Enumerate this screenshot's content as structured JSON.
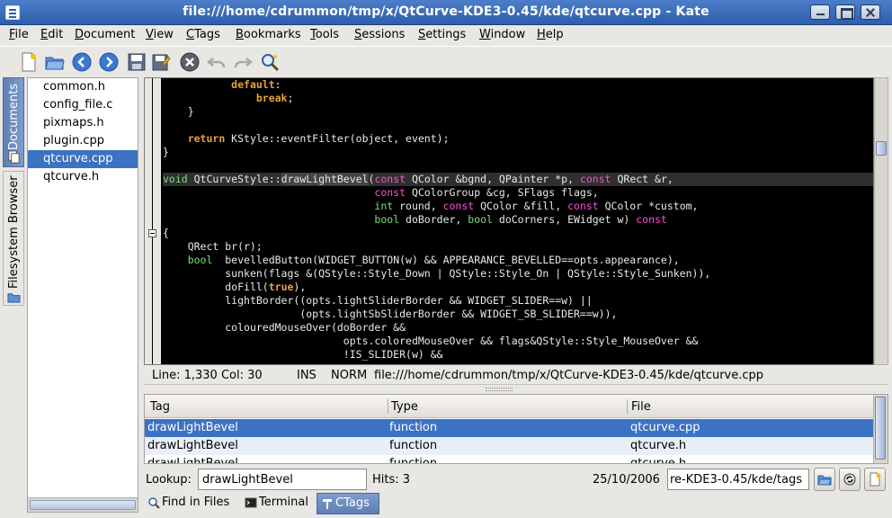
{
  "window": {
    "title": "file:///home/cdrummon/tmp/x/QtCurve-KDE3-0.45/kde/qtcurve.cpp - Kate"
  },
  "menu": [
    "File",
    "Edit",
    "Document",
    "View",
    "CTags",
    "Bookmarks",
    "Tools",
    "Sessions",
    "Settings",
    "Window",
    "Help"
  ],
  "toolbar": {
    "icons": [
      "new-document-icon",
      "open-folder-icon",
      "back-icon",
      "forward-icon",
      "save-icon",
      "save-as-icon",
      "close-document-icon",
      "undo-icon",
      "redo-icon",
      "find-icon"
    ]
  },
  "side_tabs": {
    "documents": "Documents",
    "filesystem": "Filesystem Browser"
  },
  "documents": [
    "common.h",
    "config_file.c",
    "pixmaps.h",
    "plugin.cpp",
    "qtcurve.cpp",
    "qtcurve.h"
  ],
  "selected_document": "qtcurve.cpp",
  "code": {
    "l1_kw": "default",
    "l1_rest": ":",
    "l2_kw": "break",
    "l2_rest": ";",
    "l3": "}",
    "l5_kw": "return",
    "l5_rest": " KStyle::eventFilter(object, event);",
    "l6": "}",
    "l8_a": "void",
    "l8_b": " QtCurveStyle::",
    "l8_c": "drawLightBevel",
    "l8_d": "(",
    "l8_e": "const",
    "l8_f": " QColor &bgnd, QPainter *p, ",
    "l8_g": "const",
    "l8_h": " QRect &r,",
    "l9_a": "const",
    "l9_b": " QColorGroup &cg, SFlags flags,",
    "l10_a": "int",
    "l10_b": " round, ",
    "l10_c": "const",
    "l10_d": " QColor &fill, ",
    "l10_e": "const",
    "l10_f": " QColor *custom,",
    "l11_a": "bool",
    "l11_b": " doBorder, ",
    "l11_c": "bool",
    "l11_d": " doCorners, EWidget w) ",
    "l11_e": "const",
    "l12": "{",
    "l13": "    QRect br(r);",
    "l14_a": "bool",
    "l14_b": "  bevelledButton(WIDGET_BUTTON(w) && APPEARANCE_BEVELLED==opts.appearance),",
    "l15": "sunken(flags &(QStyle::Style_Down | QStyle::Style_On | QStyle::Style_Sunken)),",
    "l16_a": "doFill(",
    "l16_b": "true",
    "l16_c": "),",
    "l17": "lightBorder((opts.lightSliderBorder && WIDGET_SLIDER==w) ||",
    "l18": "(opts.lightSbSliderBorder && WIDGET_SB_SLIDER==w)),",
    "l19": "colouredMouseOver(doBorder &&",
    "l20": "opts.coloredMouseOver && flags&QStyle::Style_MouseOver &&",
    "l21": "!IS_SLIDER(w) &&"
  },
  "status": {
    "position": "Line: 1,330 Col: 30",
    "ins": "INS",
    "norm": "NORM",
    "path": "file:///home/cdrummon/tmp/x/QtCurve-KDE3-0.45/kde/qtcurve.cpp"
  },
  "ctags": {
    "columns": [
      "Tag",
      "Type",
      "File"
    ],
    "rows": [
      {
        "tag": "drawLightBevel",
        "type": "function",
        "file": "qtcurve.cpp"
      },
      {
        "tag": "drawLightBevel",
        "type": "function",
        "file": "qtcurve.h"
      },
      {
        "tag": "drawLightBevel",
        "type": "function",
        "file": "qtcurve.h"
      }
    ],
    "lookup_label": "Lookup:",
    "lookup_value": "drawLightBevel",
    "hits": "Hits: 3",
    "date": "25/10/2006",
    "tag_file": "re-KDE3-0.45/kde/tags"
  },
  "bottom_tabs": [
    "Find in Files",
    "Terminal",
    "CTags"
  ],
  "colors": {
    "selection": "#3c72c3",
    "titlebar": "#2d5eaa",
    "keyword": "#e7a23a",
    "type": "#7be078",
    "const": "#ff4fd5"
  }
}
